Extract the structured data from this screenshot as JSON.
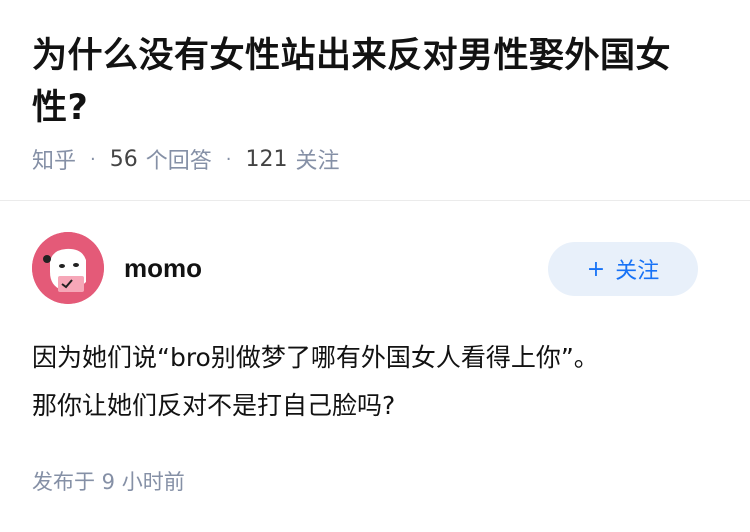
{
  "question": {
    "title": "为什么没有女性站出来反对男性娶外国女性?",
    "source": "知乎",
    "answer_count": "56",
    "answer_label": "个回答",
    "follower_count": "121",
    "follower_label": "关注"
  },
  "answer": {
    "author": {
      "name": "momo",
      "avatar_icon": "avatar-illustration-icon"
    },
    "follow_label": "关注",
    "follow_icon": "plus-icon",
    "paragraphs": [
      "因为她们说“bro别做梦了哪有外国女人看得上你”。",
      "那你让她们反对不是打自己脸吗?"
    ],
    "publish_time": "发布于 9 小时前"
  },
  "colors": {
    "title": "#121212",
    "meta": "#8590a6",
    "follow_bg": "#e8f0fa",
    "follow_text": "#1772f6",
    "avatar_bg": "#e45a78"
  }
}
